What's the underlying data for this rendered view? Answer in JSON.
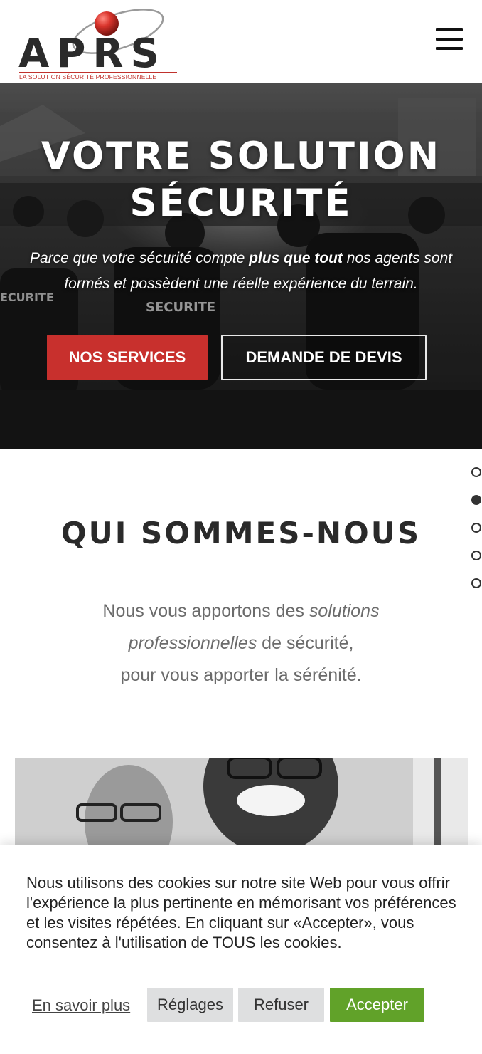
{
  "header": {
    "logo_text": "APRS",
    "logo_tagline": "LA SOLUTION SÉCURITÉ PROFESSIONNELLE",
    "menu_icon": "hamburger-menu-icon"
  },
  "hero": {
    "title_line1": "VOTRE SOLUTION",
    "title_line2": "SÉCURITÉ",
    "subtitle_part1": "Parce que votre sécurité compte ",
    "subtitle_bold": "plus que tout",
    "subtitle_part2": " nos agents sont formés et possèdent une réelle expérience du terrain.",
    "btn_services": "NOS SERVICES",
    "btn_devis": "DEMANDE DE DEVIS"
  },
  "nav_dots": {
    "count": 5,
    "active_index": 1
  },
  "about": {
    "title": "QUI SOMMES-NOUS",
    "text_part1": "Nous vous apportons des ",
    "text_italic": "solutions professionnelles",
    "text_part2": " de sécurité,",
    "text_line3": "pour vous apporter la sérénité."
  },
  "cookie": {
    "text": "Nous utilisons des cookies sur notre site Web pour vous offrir l'expérience la plus pertinente en mémorisant vos préférences et les visites répétées. En cliquant sur «Accepter», vous consentez à l'utilisation de TOUS les cookies.",
    "learn_more": "En savoir plus",
    "settings": "Réglages",
    "refuse": "Refuser",
    "accept": "Accepter"
  },
  "colors": {
    "brand_red": "#c8302d",
    "accept_green": "#61a229",
    "button_grey": "#dedfe0"
  }
}
